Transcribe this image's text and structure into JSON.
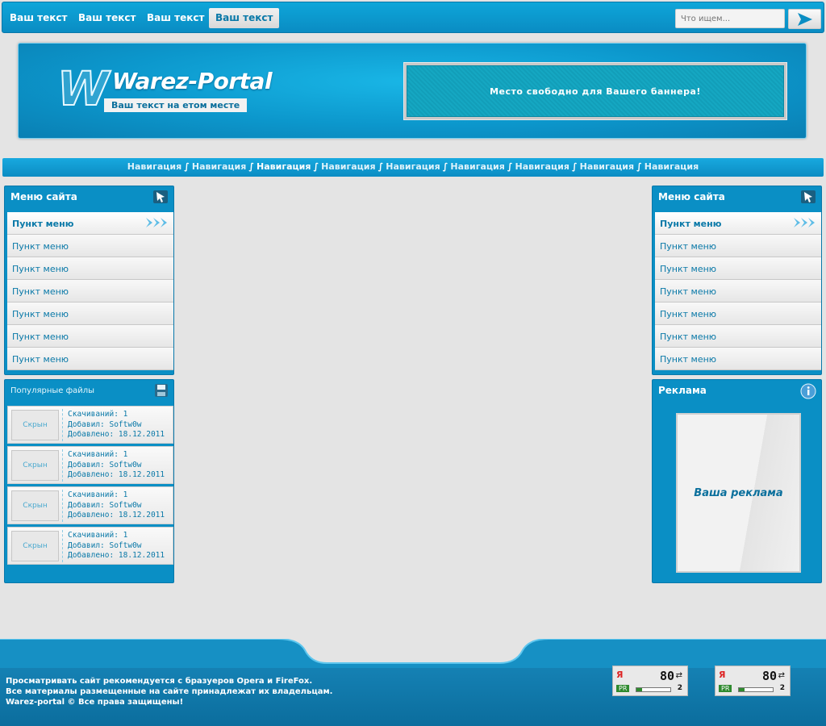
{
  "topbar": {
    "links": [
      "Ваш текст",
      "Ваш текст",
      "Ваш текст",
      "Ваш текст"
    ],
    "search_placeholder": "Что ищем..."
  },
  "header": {
    "logo_letter": "W",
    "logo_text": "Warez-Portal",
    "slogan": "Ваш текст на етом месте",
    "banner_text": "Место свободно для Вашего баннера!"
  },
  "nav": {
    "separator": "∫",
    "items": [
      "Навигация",
      "Навигация",
      "Навигация",
      "Навигация",
      "Навигация",
      "Навигация",
      "Навигация",
      "Навигация",
      "Навигация"
    ]
  },
  "left_menu": {
    "title": "Меню сайта",
    "items": [
      "Пункт меню",
      "Пункт меню",
      "Пункт меню",
      "Пункт меню",
      "Пункт меню",
      "Пункт меню",
      "Пункт меню"
    ]
  },
  "popular": {
    "title": "Популярные файлы",
    "files": [
      {
        "thumb": "Скрын",
        "downloads": "Скачиваний: 1",
        "author": "Добавил: Softw0w",
        "date": "Добавлено: 18.12.2011"
      },
      {
        "thumb": "Скрын",
        "downloads": "Скачиваний: 1",
        "author": "Добавил: Softw0w",
        "date": "Добавлено: 18.12.2011"
      },
      {
        "thumb": "Скрын",
        "downloads": "Скачиваний: 1",
        "author": "Добавил: Softw0w",
        "date": "Добавлено: 18.12.2011"
      },
      {
        "thumb": "Скрын",
        "downloads": "Скачиваний: 1",
        "author": "Добавил: Softw0w",
        "date": "Добавлено: 18.12.2011"
      }
    ]
  },
  "right_menu": {
    "title": "Меню сайта",
    "items": [
      "Пункт меню",
      "Пункт меню",
      "Пункт меню",
      "Пункт меню",
      "Пункт меню",
      "Пункт меню",
      "Пункт меню"
    ]
  },
  "ad": {
    "title": "Реклама",
    "text": "Ваша реклама"
  },
  "footer": {
    "line1": "Просматривать сайт рекомендуется с бразуеров Opera и FireFox.",
    "line2": "Все материалы размещенные на сайте принадлежат их владельцам.",
    "line3": "Warez-portal © Все права защищены!",
    "counters": [
      {
        "ya": "Я",
        "value": "80",
        "pr": "PR",
        "rank": "2",
        "pr_fill": 0.16
      },
      {
        "ya": "Я",
        "value": "80",
        "pr": "PR",
        "rank": "2",
        "pr_fill": 0.16
      }
    ]
  },
  "colors": {
    "accent": "#0a8fc5",
    "link": "#0a79a8",
    "background": "#e4e4e4"
  }
}
